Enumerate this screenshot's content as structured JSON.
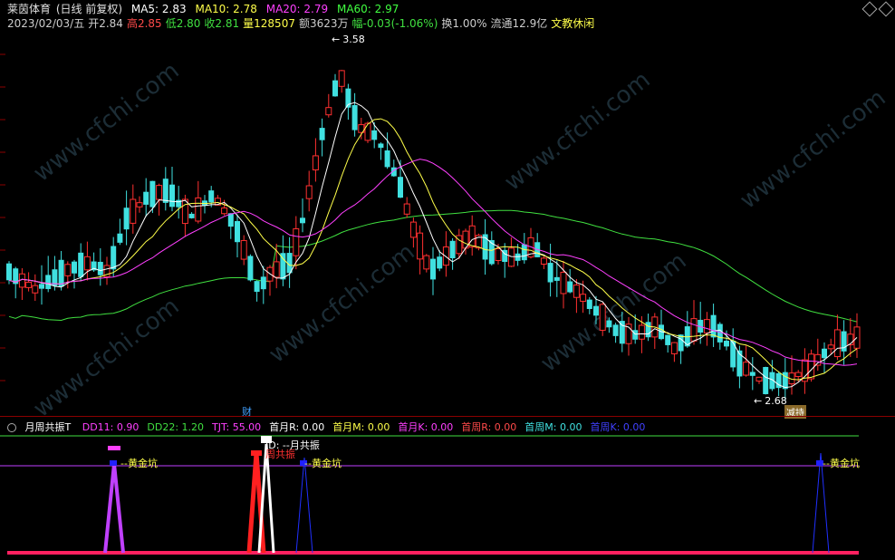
{
  "header": {
    "stock_name": "莱茵体育",
    "period_mode": "(日线 前复权)",
    "ma": [
      {
        "label": "MA5: 2.83",
        "color": "#ffffff"
      },
      {
        "label": "MA10: 2.78",
        "color": "#ffff4a"
      },
      {
        "label": "MA20: 2.79",
        "color": "#ff40ff"
      },
      {
        "label": "MA60: 2.97",
        "color": "#40ff40"
      }
    ],
    "info_row": [
      {
        "text": "2023/02/03/五",
        "color": "#cccccc"
      },
      {
        "text": "开2.84",
        "color": "#cccccc"
      },
      {
        "text": "高2.85",
        "color": "#ff4a4a"
      },
      {
        "text": "低2.80",
        "color": "#40e040"
      },
      {
        "text": "收2.81",
        "color": "#40e040"
      },
      {
        "text": "量128507",
        "color": "#ffff4a"
      },
      {
        "text": "额3623万",
        "color": "#cccccc"
      },
      {
        "text": "幅-0.03(-1.06%)",
        "color": "#40e040"
      },
      {
        "text": "换1.00%",
        "color": "#cccccc"
      },
      {
        "text": "流通12.9亿",
        "color": "#cccccc"
      },
      {
        "text": "文教休闲",
        "color": "#ffff4a"
      }
    ]
  },
  "price_marks": {
    "high": "3.58",
    "low": "2.68"
  },
  "tags": {
    "fin": "财",
    "reduce": "减持"
  },
  "indicator": {
    "name": "月周共振T",
    "params": [
      {
        "text": "DD11: 0.90",
        "color": "#ff40ff"
      },
      {
        "text": "DD22: 1.20",
        "color": "#40e040"
      },
      {
        "text": "TJT: 55.00",
        "color": "#ff40ff"
      },
      {
        "text": "首月R: 0.00",
        "color": "#ffffff"
      },
      {
        "text": "首月M: 0.00",
        "color": "#ffff4a"
      },
      {
        "text": "首月K: 0.00",
        "color": "#ff40ff"
      },
      {
        "text": "首周R: 0.00",
        "color": "#ff4a4a"
      },
      {
        "text": "首周M: 0.00",
        "color": "#40e0e0"
      },
      {
        "text": "首周K: 0.00",
        "color": "#4040ff"
      }
    ],
    "labels": {
      "gold_pit": "黄金坑",
      "resonance": "周共振",
      "month_resonance": "月共振",
      "k_prefix": "JD: "
    }
  },
  "watermark": "www.cfchi.com",
  "colors": {
    "up": "#ff3030",
    "down": "#40e0e0",
    "bg": "#000000"
  }
}
